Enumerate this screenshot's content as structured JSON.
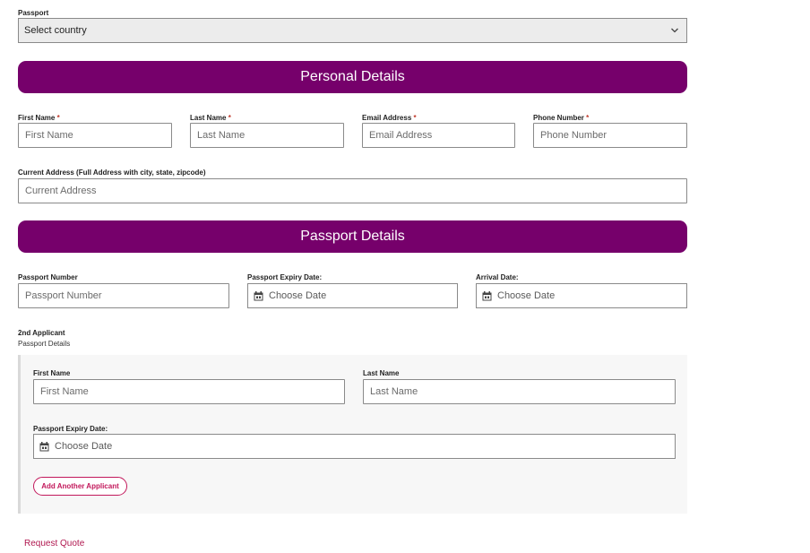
{
  "passport": {
    "label": "Passport",
    "selected": "Select country"
  },
  "personal_details": {
    "heading": "Personal Details",
    "first_name": {
      "label": "First Name",
      "required": "*",
      "placeholder": "First Name"
    },
    "last_name": {
      "label": "Last Name",
      "required": "*",
      "placeholder": "Last Name"
    },
    "email": {
      "label": "Email Address",
      "required": "*",
      "placeholder": "Email Address"
    },
    "phone": {
      "label": "Phone Number",
      "required": "*",
      "placeholder": "Phone Number"
    },
    "address": {
      "label": "Current Address (Full Address with city, state, zipcode)",
      "placeholder": "Current Address"
    }
  },
  "passport_details": {
    "heading": "Passport Details",
    "passport_number": {
      "label": "Passport Number",
      "placeholder": "Passport Number"
    },
    "expiry_date": {
      "label": "Passport Expiry Date:",
      "placeholder": "Choose Date"
    },
    "arrival_date": {
      "label": "Arrival Date:",
      "placeholder": "Choose Date"
    }
  },
  "second_applicant": {
    "title": "2nd Applicant",
    "subtitle": "Passport Details",
    "first_name": {
      "label": "First Name",
      "placeholder": "First Name"
    },
    "last_name": {
      "label": "Last Name",
      "placeholder": "Last Name"
    },
    "expiry_date": {
      "label": "Passport Expiry Date:",
      "placeholder": "Choose Date"
    },
    "add_button": "Add Another Applicant"
  },
  "actions": {
    "request_quote": "Request Quote"
  },
  "colors": {
    "banner": "#76006b",
    "accent": "#c2185b",
    "required": "#c0392b"
  },
  "icons": {
    "select_arrow": "chevron-down-icon",
    "date": "calendar-icon"
  }
}
